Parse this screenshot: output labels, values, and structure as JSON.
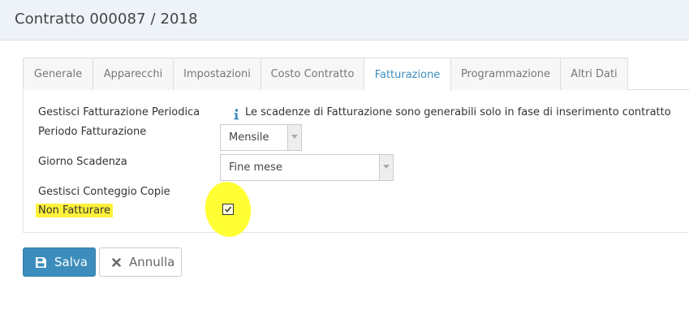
{
  "header": {
    "title": "Contratto 000087 / 2018"
  },
  "tabs": [
    {
      "label": "Generale"
    },
    {
      "label": "Apparecchi"
    },
    {
      "label": "Impostazioni"
    },
    {
      "label": "Costo Contratto"
    },
    {
      "label": "Fatturazione",
      "active": true
    },
    {
      "label": "Programmazione"
    },
    {
      "label": "Altri Dati"
    }
  ],
  "form": {
    "periodic_billing_label": "Gestisci Fatturazione Periodica",
    "info_text": "Le scadenze di Fatturazione sono generabili solo in fase di inserimento contratto",
    "billing_period_label": "Periodo Fatturazione",
    "billing_period_value": "Mensile",
    "due_day_label": "Giorno Scadenza",
    "due_day_value": "Fine mese",
    "copy_count_label": "Gestisci Conteggio Copie",
    "no_invoice_label": "Non Fatturare",
    "no_invoice_checked": true
  },
  "actions": {
    "save_label": "Salva",
    "cancel_label": "Annulla"
  },
  "colors": {
    "accent": "#3c8dbc",
    "highlight": "#ffff33"
  },
  "icons": {
    "info": "info-icon",
    "save": "floppy-disk-icon",
    "cancel": "close-icon",
    "dropdown": "caret-down-icon",
    "check": "check-icon"
  }
}
